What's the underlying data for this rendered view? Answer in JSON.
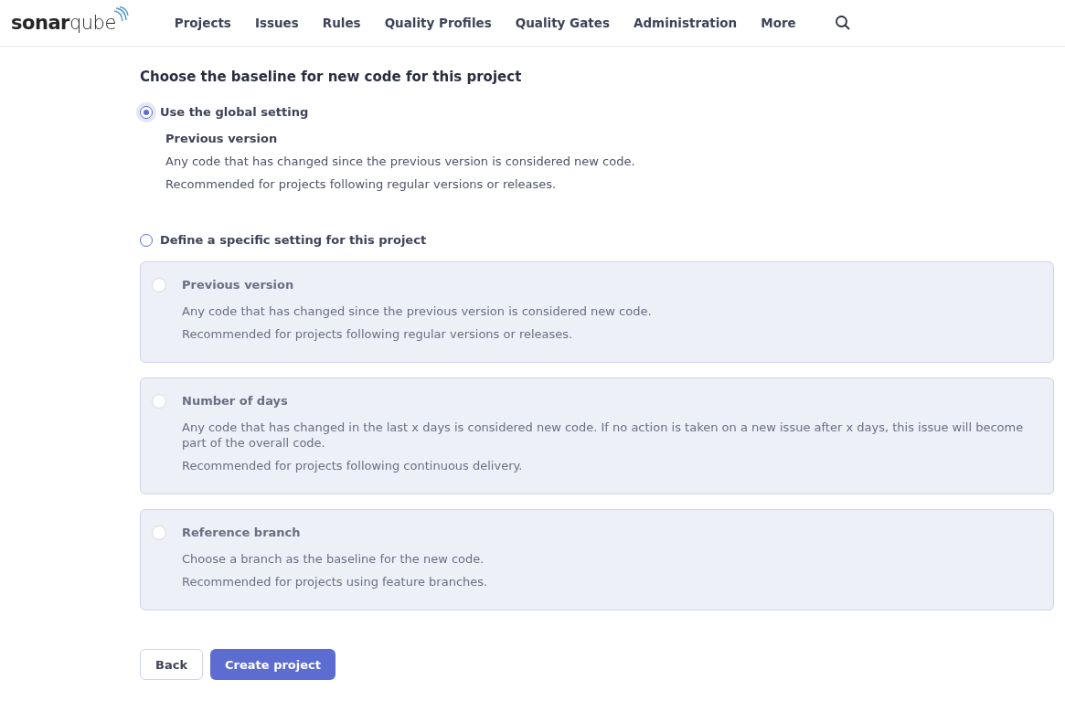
{
  "nav": {
    "logo": "**sonar**qube",
    "items": [
      {
        "label": "Projects",
        "selected": false
      },
      {
        "label": "Issues",
        "selected": false
      },
      {
        "label": "Rules",
        "selected": false
      },
      {
        "label": "Quality Profiles",
        "selected": false
      },
      {
        "label": "Quality Gates",
        "selected": false
      },
      {
        "label": "Administration",
        "selected": false
      },
      {
        "label": "More",
        "selected": false
      }
    ]
  },
  "heading": "Choose the baseline for new code for this project",
  "global_option": {
    "label": "Use the global setting",
    "selected": true,
    "title": "Previous version",
    "lines": [
      "Any code that has changed since the previous version is considered new code.",
      "Recommended for projects following regular versions or releases."
    ]
  },
  "specific_option": {
    "label": "Define a specific setting for this project",
    "selected": false,
    "choices": [
      {
        "title": "Previous version",
        "selected": false,
        "disabled": true,
        "lines": [
          "Any code that has changed since the previous version is considered new code.",
          "Recommended for projects following regular versions or releases."
        ]
      },
      {
        "title": "Number of days",
        "selected": false,
        "disabled": true,
        "lines": [
          "Any code that has changed in the last x days is considered new code. If no action is taken on a new issue after x days, this issue will become part of the overall code.",
          "Recommended for projects following continuous delivery."
        ]
      },
      {
        "title": "Reference branch",
        "selected": false,
        "disabled": true,
        "lines": [
          "Choose a branch as the baseline for the new code.",
          "Recommended for projects using feature branches."
        ]
      }
    ]
  },
  "buttons": {
    "back": "Back",
    "create": "Create project"
  }
}
